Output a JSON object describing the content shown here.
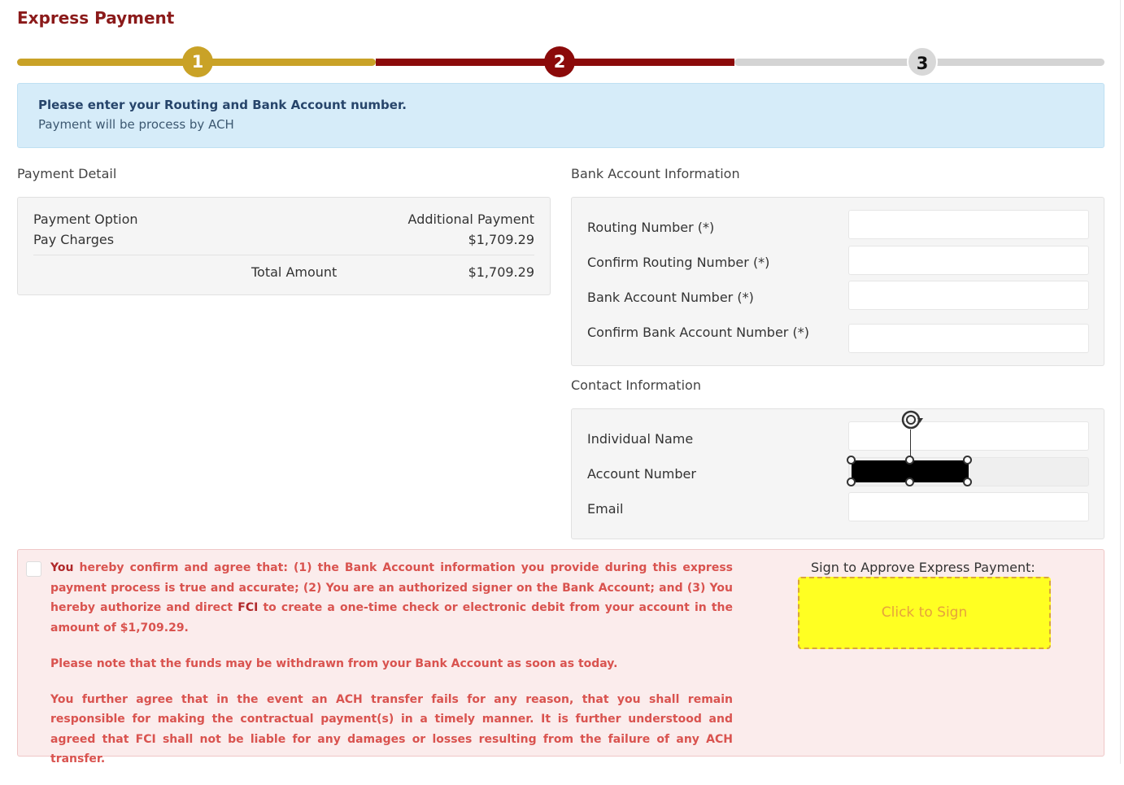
{
  "page": {
    "title": "Express Payment"
  },
  "stepper": {
    "steps": [
      "1",
      "2",
      "3"
    ],
    "current": 2
  },
  "alert": {
    "line1": "Please enter your Routing and Bank Account number.",
    "line2": "Payment will be process by ACH"
  },
  "payment_detail": {
    "heading": "Payment Detail",
    "option_label": "Payment Option",
    "option_value": "Additional Payment",
    "charges_label": "Pay Charges",
    "charges_value": "$1,709.29",
    "total_label": "Total Amount",
    "total_value": "$1,709.29"
  },
  "bank_info": {
    "heading": "Bank Account Information",
    "fields": [
      {
        "label": "Routing Number (*)",
        "value": ""
      },
      {
        "label": "Confirm Routing Number (*)",
        "value": ""
      },
      {
        "label": "Bank Account Number (*)",
        "value": ""
      },
      {
        "label": "Confirm Bank Account Number (*)",
        "value": ""
      }
    ]
  },
  "contact_info": {
    "heading": "Contact Information",
    "fields": [
      {
        "label": "Individual Name",
        "value": ""
      },
      {
        "label": "Account Number",
        "value": ""
      },
      {
        "label": "Email",
        "value": ""
      }
    ]
  },
  "agreement": {
    "p1_you": "You",
    "p1_part1": " hereby confirm and agree that: (1) the Bank Account information you provide during this express payment process is true and accurate; (2) You are an authorized signer on the Bank Account; and (3) You hereby authorize and direct ",
    "p1_fci": "FCI",
    "p1_part2": " to create a one-time check or electronic debit from your account in the amount of $1,709.29.",
    "p2": "Please note that the funds may be withdrawn from your Bank Account as soon as today.",
    "p3": "You further agree that in the event an ACH transfer fails for any reason, that you shall remain responsible for making the contractual payment(s) in a timely manner. It is further understood and agreed that FCI shall not be liable for any damages or losses resulting from the failure of any ACH transfer."
  },
  "signature": {
    "label": "Sign to Approve Express Payment:",
    "button": "Click to Sign"
  },
  "colors": {
    "title": "#8b1a1a",
    "step1": "#c9a227",
    "step2": "#8b0a0a",
    "step3": "#d4d4d4",
    "alert_bg": "#d6ecf9",
    "agree_text": "#d9534f",
    "sign_bg": "#ffff22"
  }
}
